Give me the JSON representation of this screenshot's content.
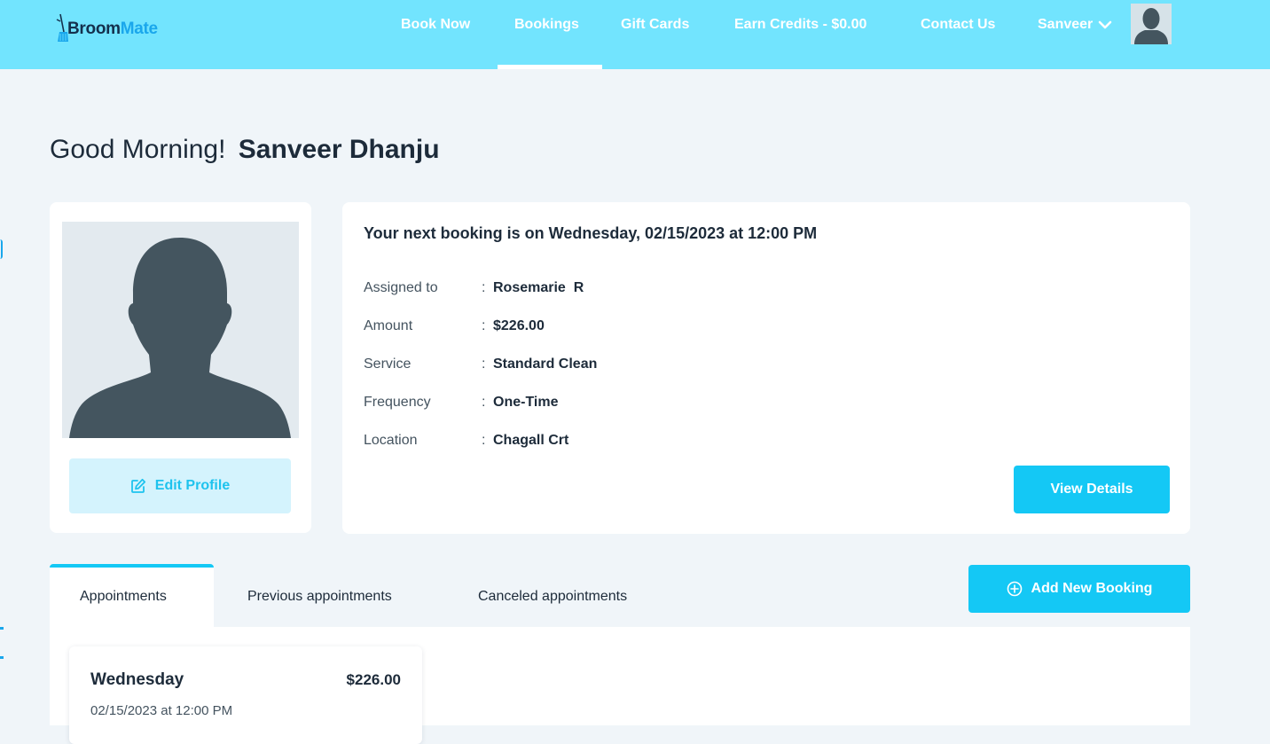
{
  "brand": {
    "part1": "Broom",
    "part2": "Mate"
  },
  "nav": {
    "items": [
      {
        "label": "Book Now"
      },
      {
        "label": "Bookings"
      },
      {
        "label": "Gift Cards"
      },
      {
        "label": "Earn Credits - $0.00"
      },
      {
        "label": "Contact Us"
      }
    ],
    "active": "Bookings",
    "user_label": "Sanveer"
  },
  "greeting": {
    "prefix": "Good Morning!",
    "name": "Sanveer Dhanju"
  },
  "profile": {
    "edit_label": "Edit Profile"
  },
  "next_booking": {
    "title": "Your next booking is on Wednesday, 02/15/2023 at 12:00 PM",
    "details": [
      {
        "label": "Assigned to",
        "value": "Rosemarie  R"
      },
      {
        "label": "Amount",
        "value": "$226.00"
      },
      {
        "label": "Service",
        "value": "Standard Clean"
      },
      {
        "label": "Frequency",
        "value": "One-Time"
      },
      {
        "label": "Location",
        "value": "Chagall Crt"
      }
    ],
    "separator": ":",
    "view_label": "View Details"
  },
  "tabs": {
    "items": [
      {
        "label": "Appointments"
      },
      {
        "label": "Previous appointments"
      },
      {
        "label": "Canceled appointments"
      }
    ],
    "active": "Appointments"
  },
  "add_booking_label": "Add New Booking",
  "appointments": [
    {
      "day": "Wednesday",
      "amount": "$226.00",
      "datetime": "02/15/2023 at 12:00 PM"
    }
  ],
  "colors": {
    "topbar": "#72e4fe",
    "accent": "#14c8f5",
    "page_bg": "#f0f5f9",
    "text_dark": "#1d2b3a"
  }
}
